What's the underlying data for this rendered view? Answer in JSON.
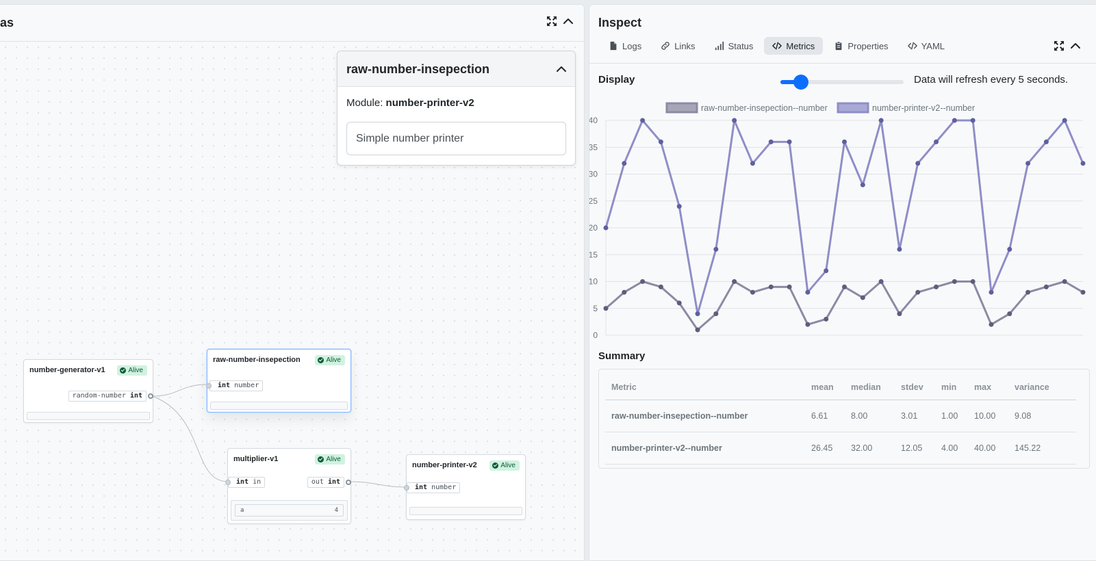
{
  "canvas": {
    "title": "vas",
    "popup": {
      "title": "raw-number-insepection",
      "module_label": "Module:",
      "module_name": "number-printer-v2",
      "description": "Simple number printer"
    },
    "nodes": {
      "generator": {
        "title": "number-generator-v1",
        "status": "Alive",
        "out_name": "random-number",
        "out_type": "int"
      },
      "inspection": {
        "title": "raw-number-insepection",
        "status": "Alive",
        "in_type": "int",
        "in_name": "number"
      },
      "multiplier": {
        "title": "multiplier-v1",
        "status": "Alive",
        "in_type": "int",
        "in_name": "in",
        "out_name": "out",
        "out_type": "int",
        "param_name": "a",
        "param_value": "4"
      },
      "printer": {
        "title": "number-printer-v2",
        "status": "Alive",
        "in_type": "int",
        "in_name": "number"
      }
    }
  },
  "inspect": {
    "title": "Inspect",
    "tabs": [
      {
        "label": "Logs",
        "icon": "file-icon"
      },
      {
        "label": "Links",
        "icon": "link-icon"
      },
      {
        "label": "Status",
        "icon": "signal-icon"
      },
      {
        "label": "Metrics",
        "icon": "code-icon",
        "active": true
      },
      {
        "label": "Properties",
        "icon": "clipboard-icon"
      },
      {
        "label": "YAML",
        "icon": "code-icon"
      }
    ],
    "display_label": "Display",
    "refresh_seconds": 5,
    "refresh_text": "Data will refresh every 5 seconds.",
    "slider": {
      "min": 1,
      "max": 60,
      "value": 5
    },
    "summary_label": "Summary",
    "summary": {
      "headers": [
        "Metric",
        "mean",
        "median",
        "stdev",
        "min",
        "max",
        "variance"
      ],
      "rows": [
        [
          "raw-number-insepection--number",
          "6.61",
          "8.00",
          "3.01",
          "1.00",
          "10.00",
          "9.08"
        ],
        [
          "number-printer-v2--number",
          "26.45",
          "32.00",
          "12.05",
          "4.00",
          "40.00",
          "145.22"
        ]
      ]
    }
  },
  "chart_data": {
    "type": "line",
    "legend_position": "top-center",
    "grid": true,
    "ylim": [
      0,
      40
    ],
    "yticks": [
      0,
      5,
      10,
      15,
      20,
      25,
      30,
      35,
      40
    ],
    "series": [
      {
        "name": "raw-number-insepection--number",
        "color": "#8c8aa3",
        "values": [
          5,
          8,
          10,
          9,
          6,
          1,
          4,
          10,
          8,
          9,
          9,
          2,
          3,
          9,
          7,
          10,
          4,
          8,
          9,
          10,
          10,
          2,
          4,
          8,
          9,
          10,
          8
        ]
      },
      {
        "name": "number-printer-v2--number",
        "color": "#8e8ec8",
        "values": [
          20,
          32,
          40,
          36,
          24,
          4,
          16,
          40,
          32,
          36,
          36,
          8,
          12,
          36,
          28,
          40,
          16,
          32,
          36,
          40,
          40,
          8,
          16,
          32,
          36,
          40,
          32
        ]
      }
    ]
  },
  "colors": {
    "accent": "#0d6efd",
    "alive_bg": "#d1f2e1",
    "alive_fg": "#0a5c36"
  }
}
